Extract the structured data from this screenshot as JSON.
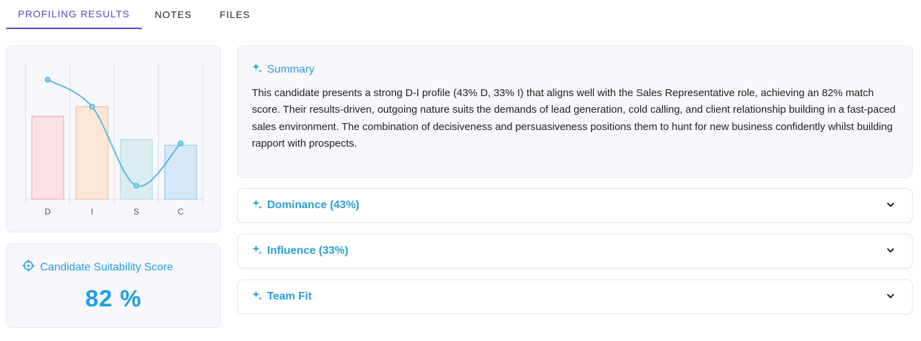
{
  "tabs": [
    {
      "label": "PROFILING RESULTS",
      "active": true
    },
    {
      "label": "NOTES",
      "active": false
    },
    {
      "label": "FILES",
      "active": false
    }
  ],
  "chart_data": {
    "type": "bar",
    "categories": [
      "D",
      "I",
      "S",
      "C"
    ],
    "values": [
      43,
      48,
      31,
      28
    ],
    "line_values": [
      62,
      48,
      7,
      29
    ],
    "ylim": [
      0,
      70
    ],
    "colors": {
      "fills": [
        "#fde0e6",
        "#fde6d6",
        "#dcedf2",
        "#d6e8f8"
      ],
      "strokes": [
        "#f0a0a8",
        "#f0b090",
        "#a8d4e0",
        "#8cc0e8"
      ],
      "line": "#5bb8dd"
    },
    "grid": true
  },
  "score": {
    "icon": "crosshair-icon",
    "title": "Candidate Suitability Score",
    "value": "82 %"
  },
  "summary": {
    "icon": "sparkle-icon",
    "title": "Summary",
    "text": "This candidate presents a strong D-I profile (43% D, 33% I) that aligns well with the Sales Representative role, achieving an 82% match score. Their results-driven, outgoing nature suits the demands of lead generation, cold calling, and client relationship building in a fast-paced sales environment. The combination of decisiveness and persuasiveness positions them to hunt for new business confidently whilst building rapport with prospects."
  },
  "accordions": [
    {
      "label": "Dominance (43%)",
      "icon": "sparkle-icon"
    },
    {
      "label": "Influence (33%)",
      "icon": "sparkle-icon"
    },
    {
      "label": "Team Fit",
      "icon": "sparkle-icon"
    }
  ],
  "accent_color": "#2a9fd6",
  "tab_accent_color": "#5b3fc4"
}
